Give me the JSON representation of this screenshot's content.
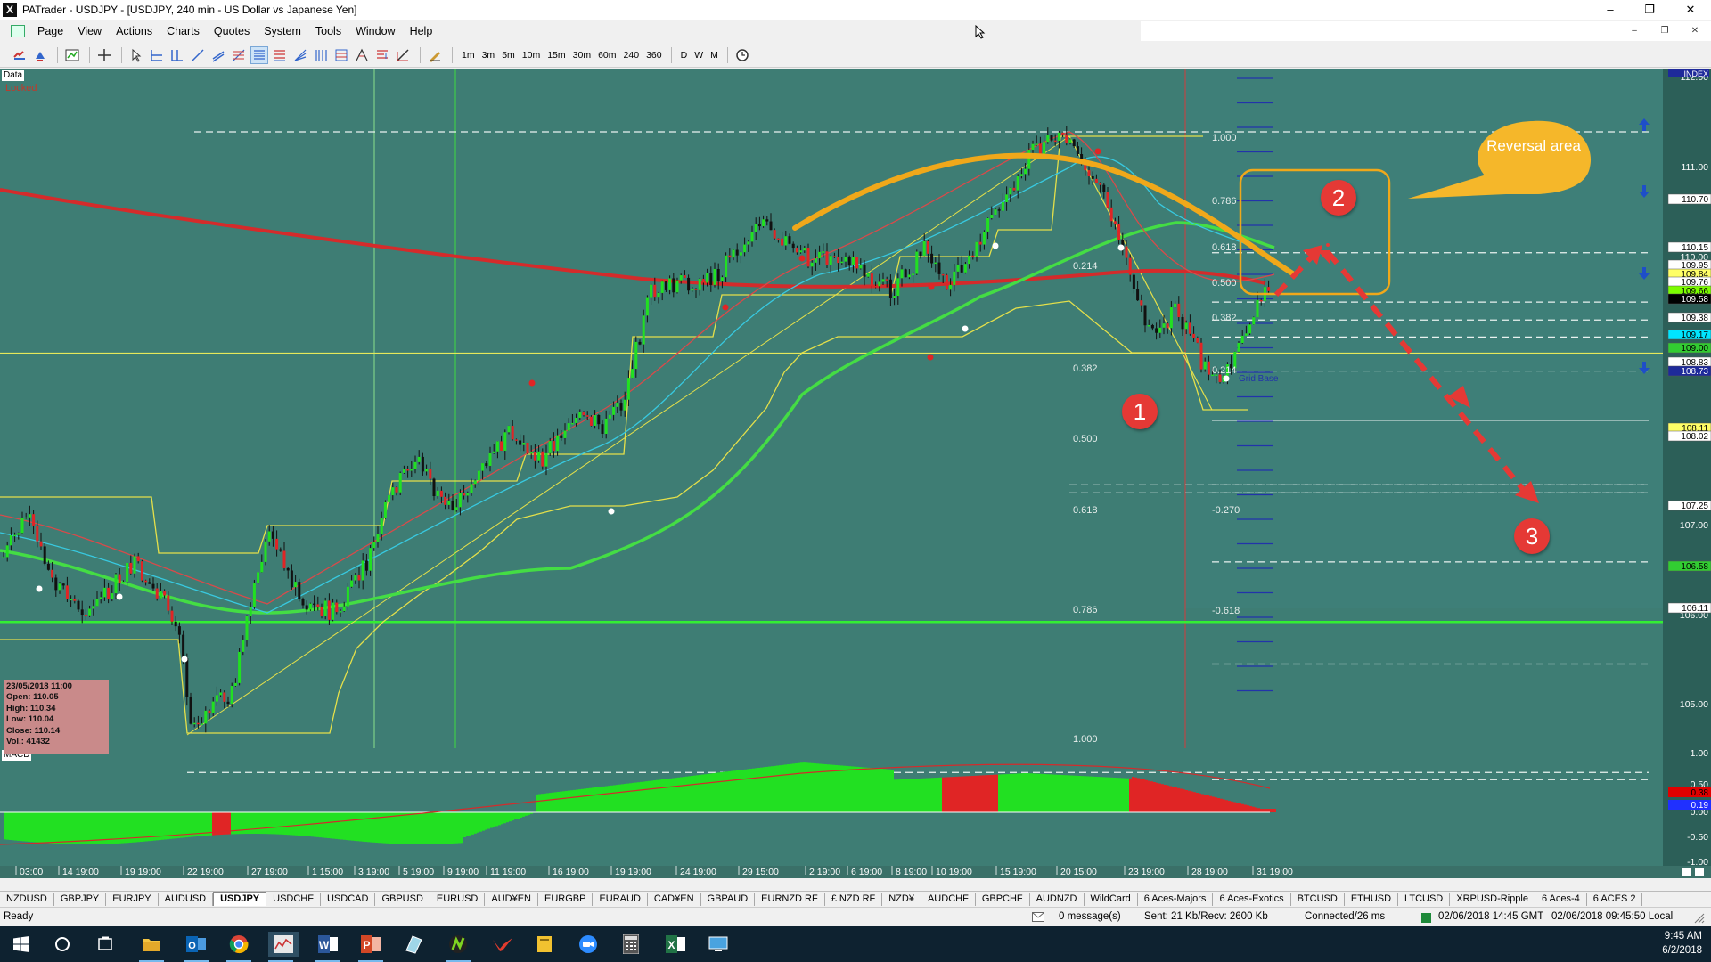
{
  "window": {
    "app_icon": "X",
    "title": "PATrader - USDJPY - [USDJPY, 240 min - US Dollar vs Japanese Yen]",
    "minimize": "–",
    "maximize": "❐",
    "close": "✕"
  },
  "menu": [
    "Page",
    "View",
    "Actions",
    "Charts",
    "Quotes",
    "System",
    "Tools",
    "Window",
    "Help"
  ],
  "toolbar": {
    "timeframes": [
      "1m",
      "3m",
      "5m",
      "10m",
      "15m",
      "30m",
      "60m",
      "240",
      "360"
    ],
    "periods": [
      "D",
      "W",
      "M"
    ]
  },
  "chart": {
    "data_label": "Data",
    "locked_label": "Locked",
    "macd_label": "MACD",
    "index_label": "INDEX",
    "ohlc": {
      "date": "23/05/2018 11:00",
      "open": "Open: 110.05",
      "high": "High: 110.34",
      "low": "Low: 110.04",
      "close": "Close: 110.14",
      "vol": "Vol.: 41432"
    },
    "price_scale": [
      "112.00",
      "111.00",
      "110.00",
      "109.00",
      "108.00",
      "107.00",
      "106.00",
      "105.00"
    ],
    "price_tags": [
      {
        "text": "110.70",
        "bg": "#ffffff",
        "fg": "#000000"
      },
      {
        "text": "110.15",
        "bg": "#ffffff",
        "fg": "#000000"
      },
      {
        "text": "109.95",
        "bg": "#ffffff",
        "fg": "#000000"
      },
      {
        "text": "109.84",
        "bg": "#ffff66",
        "fg": "#000000"
      },
      {
        "text": "109.76",
        "bg": "#ffffff",
        "fg": "#000000"
      },
      {
        "text": "109.66",
        "bg": "#7cfc00",
        "fg": "#000000"
      },
      {
        "text": "109.58",
        "bg": "#000000",
        "fg": "#ffffff"
      },
      {
        "text": "109.38",
        "bg": "#ffffff",
        "fg": "#000000"
      },
      {
        "text": "109.17",
        "bg": "#00e5ff",
        "fg": "#000000"
      },
      {
        "text": "109.00",
        "bg": "#32cd32",
        "fg": "#000000"
      },
      {
        "text": "108.83",
        "bg": "#ffffff",
        "fg": "#000000"
      },
      {
        "text": "108.73",
        "bg": "#1e2a9a",
        "fg": "#ffffff"
      },
      {
        "text": "108.11",
        "bg": "#ffff66",
        "fg": "#000000"
      },
      {
        "text": "108.02",
        "bg": "#ffffff",
        "fg": "#000000"
      },
      {
        "text": "107.25",
        "bg": "#ffffff",
        "fg": "#000000"
      },
      {
        "text": "106.58",
        "bg": "#32cd32",
        "fg": "#000000"
      },
      {
        "text": "106.11",
        "bg": "#ffffff",
        "fg": "#000000"
      }
    ],
    "macd_scale": [
      "1.00",
      "0.50",
      "0.00",
      "-0.50",
      "-1.00"
    ],
    "macd_tags": [
      {
        "text": "0.38",
        "bg": "#e00000",
        "fg": "#000000"
      },
      {
        "text": "0.19",
        "bg": "#2030ff",
        "fg": "#ffffff"
      }
    ],
    "fib_labels": [
      "1.000",
      "0.786",
      "0.618",
      "0.500",
      "0.382",
      "0.214",
      "0.214",
      "0.382",
      "0.500",
      "0.618",
      "0.786",
      "1.000",
      "-0.270",
      "-0.618"
    ],
    "grid_base_label": "Grid Base",
    "time_axis": [
      "03:00",
      "14 19:00",
      "19 19:00",
      "22 19:00",
      "27 19:00",
      "1 15:00",
      "3 19:00",
      "5 19:00",
      "9 19:00",
      "11 19:00",
      "16 19:00",
      "19 19:00",
      "24 19:00",
      "29 15:00",
      "2 19:00",
      "6 19:00",
      "8 19:00",
      "10 19:00",
      "15 19:00",
      "20 15:00",
      "23 19:00",
      "28 19:00",
      "31 19:00"
    ],
    "annotations": {
      "callout": "Reversal area",
      "markers": [
        "1",
        "2",
        "3"
      ]
    }
  },
  "tabs": [
    "NZDUSD",
    "GBPJPY",
    "EURJPY",
    "AUDUSD",
    "USDJPY",
    "USDCHF",
    "USDCAD",
    "GBPUSD",
    "EURUSD",
    "AUD¥EN",
    "EURGBP",
    "EURAUD",
    "CAD¥EN",
    "GBPAUD",
    "EURNZD RF",
    "£ NZD RF",
    "NZD¥",
    "AUDCHF",
    "GBPCHF",
    "AUDNZD",
    "WildCard",
    "6 Aces-Majors",
    "6 Aces-Exotics",
    "BTCUSD",
    "ETHUSD",
    "LTCUSD",
    "XRPUSD-Ripple",
    "6 Aces-4",
    "6 ACES 2"
  ],
  "active_tab": "USDJPY",
  "status": {
    "ready": "Ready",
    "messages": "0 message(s)",
    "traffic": "Sent: 21 Kb/Recv: 2600 Kb",
    "connection": "Connected/26 ms",
    "server_time": "02/06/2018 14:45 GMT",
    "local_time": "02/06/2018 09:45:50 Local"
  },
  "taskbar": {
    "time": "9:45 AM",
    "date": "6/2/2018"
  }
}
